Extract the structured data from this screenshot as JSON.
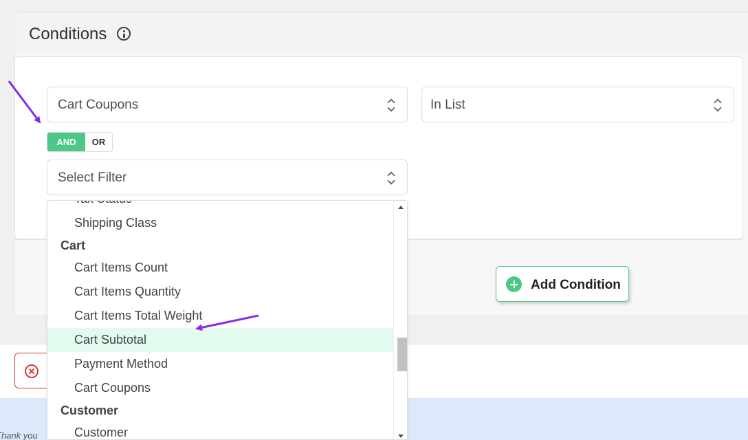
{
  "panel": {
    "title": "Conditions"
  },
  "condition": {
    "field": "Cart Coupons",
    "operator": "In List",
    "and_label": "AND",
    "or_label": "OR",
    "filter_placeholder": "Select Filter"
  },
  "dropdown": {
    "items": [
      {
        "type": "option",
        "label": "Tax Status"
      },
      {
        "type": "option",
        "label": "Shipping Class"
      },
      {
        "type": "group",
        "label": "Cart"
      },
      {
        "type": "option",
        "label": "Cart Items Count"
      },
      {
        "type": "option",
        "label": "Cart Items Quantity"
      },
      {
        "type": "option",
        "label": "Cart Items Total Weight"
      },
      {
        "type": "option",
        "label": "Cart Subtotal",
        "highlighted": true
      },
      {
        "type": "option",
        "label": "Payment Method"
      },
      {
        "type": "option",
        "label": "Cart Coupons"
      },
      {
        "type": "group",
        "label": "Customer"
      },
      {
        "type": "option",
        "label": "Customer"
      }
    ],
    "scroll_position": 0.68
  },
  "actions": {
    "add_condition_label": "Add Condition"
  },
  "footer": {
    "thanks_text": "Thank you"
  },
  "colors": {
    "accent_green": "#4bc985",
    "highlight_bg": "#e3fbee",
    "danger_red": "#d63638",
    "annotation_arrow": "#8a2be2"
  },
  "icons": {
    "info": "info-circle-icon",
    "chevron": "chevron-up-down-icon",
    "plus": "plus-circle-icon",
    "cancel": "x-circle-icon"
  }
}
